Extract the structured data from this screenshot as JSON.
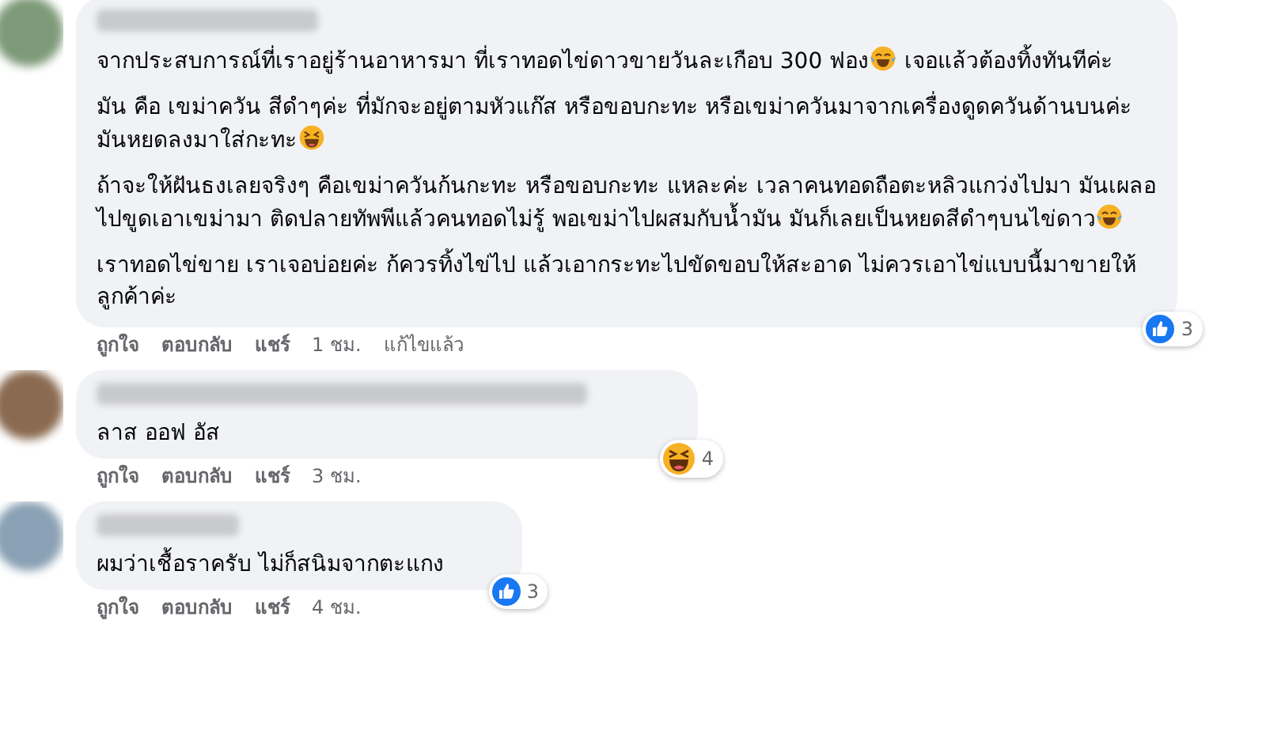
{
  "comments": [
    {
      "paragraphs": [
        [
          {
            "kind": "text",
            "text": "จากประสบการณ์ที่เราอยู่ร้านอาหารมา ที่เราทอดไข่ดาวขายวันละเกือบ 300 ฟอง"
          },
          {
            "kind": "tears"
          },
          {
            "kind": "text",
            "text": " เจอแล้วต้องทิ้งทันทีค่ะ"
          }
        ],
        [
          {
            "kind": "text",
            "text": "มัน คือ เขม่าควัน สีดำๆค่ะ ที่มักจะอยู่ตามหัวแก๊ส หรือขอบกะทะ หรือเขม่าควันมาจากเครื่องดูดควันด้านบนค่ะ มันหยดลงมาใส่กะทะ"
          },
          {
            "kind": "squint"
          }
        ],
        [
          {
            "kind": "text",
            "text": "ถ้าจะให้ฝันธงเลยจริงๆ คือเขม่าควันก้นกะทะ หรือขอบกะทะ แหละค่ะ เวลาคนทอดถือตะหลิวแกว่งไปมา มันเผลอไปขูดเอาเขม่ามา ติดปลายทัพพีแล้วคนทอดไม่รู้ พอเขม่าไปผสมกับน้ำมัน มันก็เลยเป็นหยดสีดำๆบนไข่ดาว"
          },
          {
            "kind": "tears"
          }
        ],
        [
          {
            "kind": "text",
            "text": "เราทอดไข่ขาย เราเจอบ่อยค่ะ ก้ควรทิ้งไข่ไป แล้วเอากระทะไปขัดขอบให้สะอาด ไม่ควรเอาไข่แบบนี้มาขายให้ลูกค้าค่ะ"
          }
        ]
      ],
      "reaction": {
        "kind": "like",
        "count": "3"
      },
      "actions": [
        "ถูกใจ",
        "ตอบกลับ",
        "แชร์"
      ],
      "time": "1 ชม.",
      "edited": "แก้ไขแล้ว"
    },
    {
      "paragraphs": [
        [
          {
            "kind": "text",
            "text": "ลาส ออฟ อัส"
          }
        ]
      ],
      "reaction": {
        "kind": "haha",
        "count": "4"
      },
      "actions": [
        "ถูกใจ",
        "ตอบกลับ",
        "แชร์"
      ],
      "time": "3 ชม."
    },
    {
      "paragraphs": [
        [
          {
            "kind": "text",
            "text": "ผมว่าเชื้อราครับ ไม่ก็สนิมจากตะแกง"
          }
        ]
      ],
      "reaction": {
        "kind": "like",
        "count": "3"
      },
      "actions": [
        "ถูกใจ",
        "ตอบกลับ",
        "แชร์"
      ],
      "time": "4 ชม."
    }
  ]
}
